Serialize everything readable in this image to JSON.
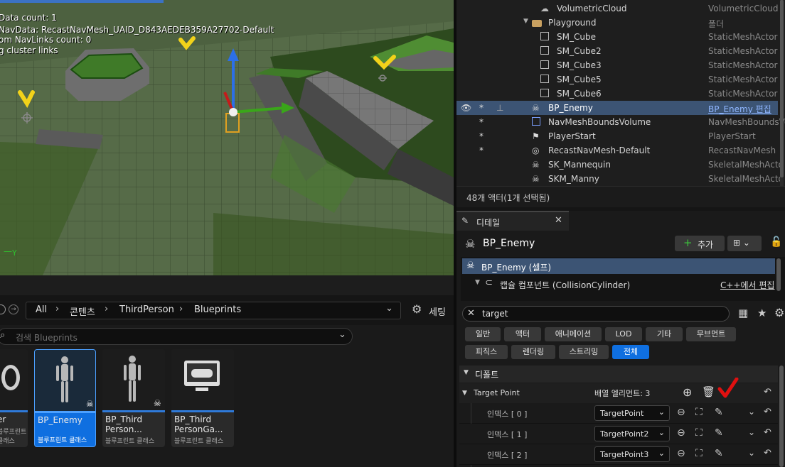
{
  "viewport": {
    "debug_lines": [
      "Data count: 1",
      "NavData: RecastNavMesh_UAID_D843AEDEB359A27702-Default",
      "om NavLinks count: 0",
      "g cluster links"
    ],
    "axis_label": "Y"
  },
  "outliner": {
    "rows": [
      {
        "name": "VolumetricCloud",
        "type": "VolumetricCloud"
      },
      {
        "name": "Playground",
        "type": "폴더"
      },
      {
        "name": "SM_Cube",
        "type": "StaticMeshActor"
      },
      {
        "name": "SM_Cube2",
        "type": "StaticMeshActor"
      },
      {
        "name": "SM_Cube3",
        "type": "StaticMeshActor"
      },
      {
        "name": "SM_Cube5",
        "type": "StaticMeshActor"
      },
      {
        "name": "SM_Cube6",
        "type": "StaticMeshActor"
      },
      {
        "name": "BP_Enemy",
        "type": "BP_Enemy 편집"
      },
      {
        "name": "NavMeshBoundsVolume",
        "type": "NavMeshBoundsVo"
      },
      {
        "name": "PlayerStart",
        "type": "PlayerStart"
      },
      {
        "name": "RecastNavMesh-Default",
        "type": "RecastNavMesh"
      },
      {
        "name": "SK_Mannequin",
        "type": "SkeletalMeshActo"
      },
      {
        "name": "SKM_Manny",
        "type": "SkeletalMeshActo"
      }
    ],
    "count_text": "48개 액터(1개 선택됨)"
  },
  "details": {
    "tab_label": "디테일",
    "title": "BP_Enemy",
    "add_label": "추가",
    "self_label": "BP_Enemy (셀프)",
    "component_label": "캡슐 컴포넌트 (CollisionCylinder)",
    "component_edit": "C++에서 편집",
    "search_value": "target",
    "filters": [
      "일반",
      "액터",
      "애니메이션",
      "LOD",
      "기타",
      "무브먼트",
      "피직스",
      "렌더링",
      "스트리밍",
      "전체"
    ],
    "section_label": "디폴트",
    "prop_label": "Target Point",
    "array_label": "배열 엘리먼트: 3",
    "items": [
      {
        "label": "인덱스 [ 0 ]",
        "value": "TargetPoint"
      },
      {
        "label": "인덱스 [ 1 ]",
        "value": "TargetPoint2"
      },
      {
        "label": "인덱스 [ 2 ]",
        "value": "TargetPoint3"
      }
    ]
  },
  "content_browser": {
    "crumbs": [
      "All",
      "콘텐츠",
      "ThirdPerson",
      "Blueprints"
    ],
    "settings_label": "세팅",
    "search_placeholder": "검색 Blueprints",
    "assets": [
      {
        "name": "er",
        "class": "블루프린트 클래스"
      },
      {
        "name": "BP_Enemy",
        "class": "블루프린트 클래스"
      },
      {
        "name": "BP_Third\nPerson...",
        "class": "블루프린트 클래스"
      },
      {
        "name": "BP_Third\nPersonGa...",
        "class": "블루프린트 클래스"
      }
    ]
  },
  "colors": {
    "accent": "#0f6fe0",
    "selection": "#3c5474",
    "annotation_yellow": "#f2d21a",
    "annotation_red": "#e01010"
  }
}
